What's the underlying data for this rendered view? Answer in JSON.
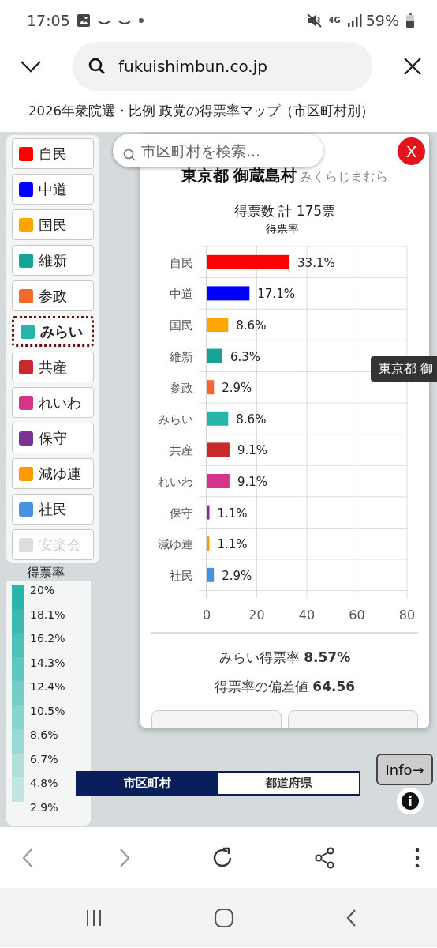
{
  "status_bar": {
    "time": "17:05",
    "battery": "59%",
    "network": "4G"
  },
  "url_bar": {
    "url": "fukuishimbun.co.jp"
  },
  "page_title": "2026年衆院選・比例 政党の得票率マップ（市区町村別）",
  "parties": [
    {
      "label": "自民",
      "color": "#ff0000",
      "selected": false,
      "disabled": false
    },
    {
      "label": "中道",
      "color": "#0000ff",
      "selected": false,
      "disabled": false
    },
    {
      "label": "国民",
      "color": "#ffa500",
      "selected": false,
      "disabled": false
    },
    {
      "label": "維新",
      "color": "#15a394",
      "selected": false,
      "disabled": false
    },
    {
      "label": "参政",
      "color": "#f26a2b",
      "selected": false,
      "disabled": false
    },
    {
      "label": "みらい",
      "color": "#26b5ab",
      "selected": true,
      "disabled": false
    },
    {
      "label": "共産",
      "color": "#c9282d",
      "selected": false,
      "disabled": false
    },
    {
      "label": "れいわ",
      "color": "#d6338a",
      "selected": false,
      "disabled": false
    },
    {
      "label": "保守",
      "color": "#7b3294",
      "selected": false,
      "disabled": false
    },
    {
      "label": "減ゆ連",
      "color": "#ff9900",
      "selected": false,
      "disabled": false
    },
    {
      "label": "社民",
      "color": "#4a90e2",
      "selected": false,
      "disabled": false
    },
    {
      "label": "安楽会",
      "color": "#dddddd",
      "selected": false,
      "disabled": true
    }
  ],
  "rate_legend": {
    "title": "得票率",
    "labels": [
      "20%",
      "18.1%",
      "16.2%",
      "14.3%",
      "12.4%",
      "10.5%",
      "8.6%",
      "6.7%",
      "4.8%",
      "2.9%"
    ]
  },
  "search": {
    "placeholder": "市区町村を検索..."
  },
  "close_button": "X",
  "popup": {
    "title": "東京都 御蔵島村",
    "reading": "みくらじまむら",
    "total": "得票数 計 175票",
    "chart_data": {
      "type": "bar",
      "orientation": "horizontal",
      "categories": [
        "自民",
        "中道",
        "国民",
        "維新",
        "参政",
        "みらい",
        "共産",
        "れいわ",
        "保守",
        "減ゆ連",
        "社民"
      ],
      "series": [
        {
          "name": "得票率",
          "values": [
            33.1,
            17.1,
            8.6,
            6.3,
            2.9,
            8.6,
            9.1,
            9.1,
            1.1,
            1.1,
            2.9
          ]
        }
      ],
      "xlim": [
        0,
        80
      ],
      "xticks": [
        0,
        20,
        40,
        60,
        80
      ],
      "grid": true,
      "value_labels": [
        "33.1%",
        "17.1%",
        "8.6%",
        "6.3%",
        "2.9%",
        "8.6%",
        "9.1%",
        "9.1%",
        "1.1%",
        "1.1%",
        "2.9%"
      ]
    },
    "rate_line": "みらい得票率 **8.57%**",
    "deviation_line": "得票率の偏差値 **64.56**"
  },
  "tooltip": "東京都 御",
  "scope_toggle": [
    {
      "label": "市区町村",
      "selected": true
    },
    {
      "label": "都道府県",
      "selected": false
    }
  ],
  "info_button": "Info→"
}
